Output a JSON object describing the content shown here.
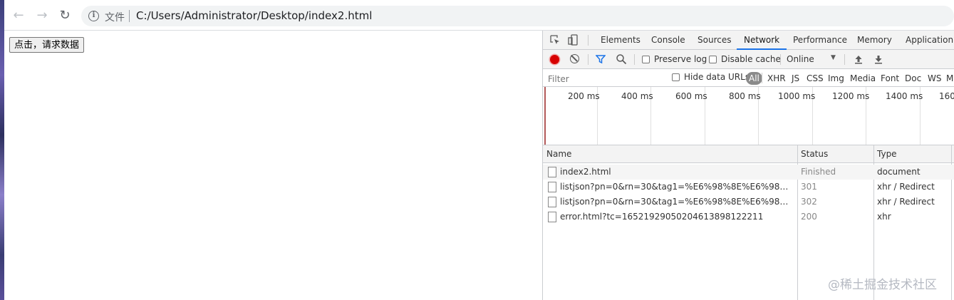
{
  "browser": {
    "back_icon": "arrow-left-icon",
    "forward_icon": "arrow-right-icon",
    "reload_icon": "reload-icon",
    "scheme_label": "文件",
    "url": "C:/Users/Administrator/Desktop/index2.html"
  },
  "page": {
    "button_label": "点击，请求数据"
  },
  "devtools": {
    "tabs": [
      "Elements",
      "Console",
      "Sources",
      "Network",
      "Performance",
      "Memory",
      "Application"
    ],
    "active_tab": "Network",
    "toolbar": {
      "preserve_log": "Preserve log",
      "disable_cache": "Disable cache",
      "throttle": "Online"
    },
    "filter": {
      "placeholder": "Filter",
      "hide_data_urls": "Hide data URLs",
      "types": [
        "All",
        "XHR",
        "JS",
        "CSS",
        "Img",
        "Media",
        "Font",
        "Doc",
        "WS",
        "M"
      ]
    },
    "timeline_ticks": [
      "200 ms",
      "400 ms",
      "600 ms",
      "800 ms",
      "1000 ms",
      "1200 ms",
      "1400 ms",
      "160"
    ],
    "columns": {
      "name": "Name",
      "status": "Status",
      "type": "Type"
    },
    "requests": [
      {
        "name": "index2.html",
        "status": "Finished",
        "type": "document"
      },
      {
        "name": "listjson?pn=0&rn=30&tag1=%E6%98%8E%E6%98%9F&tag…",
        "status": "301",
        "type": "xhr / Redirect"
      },
      {
        "name": "listjson?pn=0&rn=30&tag1=%E6%98%8E%E6%98%9F&tag…",
        "status": "302",
        "type": "xhr / Redirect"
      },
      {
        "name": "error.html?tc=16521929050204613898122211",
        "status": "200",
        "type": "xhr"
      }
    ]
  },
  "watermark": "@稀土掘金技术社区"
}
